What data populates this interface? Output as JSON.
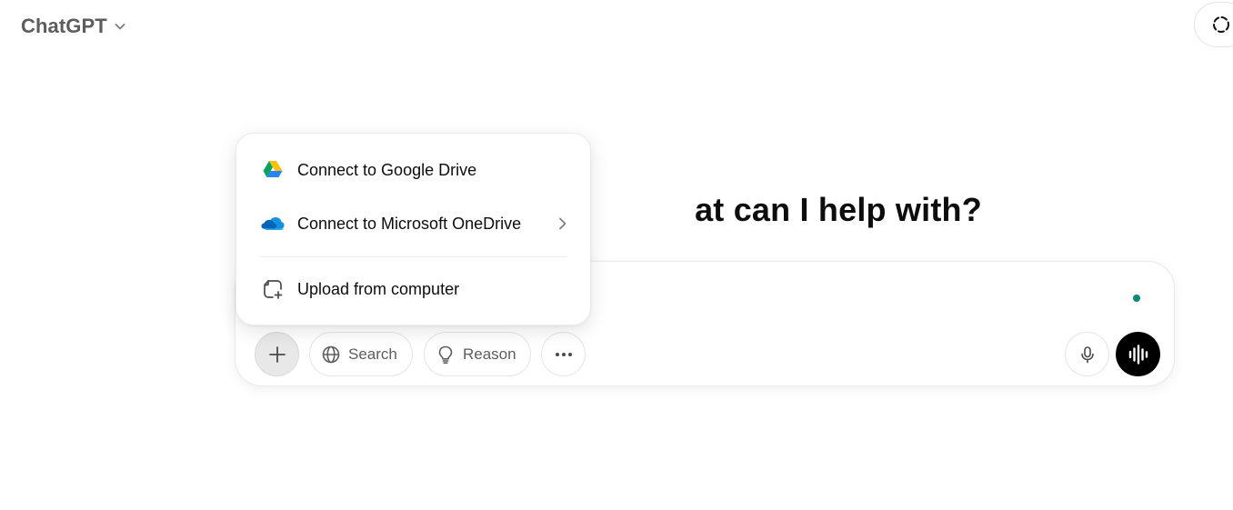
{
  "header": {
    "model_title": "ChatGPT",
    "model_chevron_icon": "chevron-down-icon",
    "temp_chat_icon": "dashed-circle-icon"
  },
  "hero": {
    "headline_visible": "at can I help with?"
  },
  "composer": {
    "status_dot_color": "#0a8a74",
    "buttons": {
      "attach_icon": "plus-icon",
      "search_label": "Search",
      "search_icon": "globe-icon",
      "reason_label": "Reason",
      "reason_icon": "lightbulb-icon",
      "more_icon": "ellipsis-icon",
      "mic_icon": "microphone-icon",
      "voice_icon": "voice-waveform-icon"
    }
  },
  "attach_menu": {
    "items": [
      {
        "label": "Connect to Google Drive",
        "icon": "google-drive-icon",
        "has_submenu": false
      },
      {
        "label": "Connect to Microsoft OneDrive",
        "icon": "onedrive-icon",
        "has_submenu": true
      },
      {
        "label": "Upload from computer",
        "icon": "upload-file-icon",
        "has_submenu": false
      }
    ]
  },
  "colors": {
    "title_gray": "#5d5d5d",
    "text": "#0d0d0d",
    "voice_button_bg": "#000000",
    "attach_button_bg": "#e8e8e8"
  }
}
